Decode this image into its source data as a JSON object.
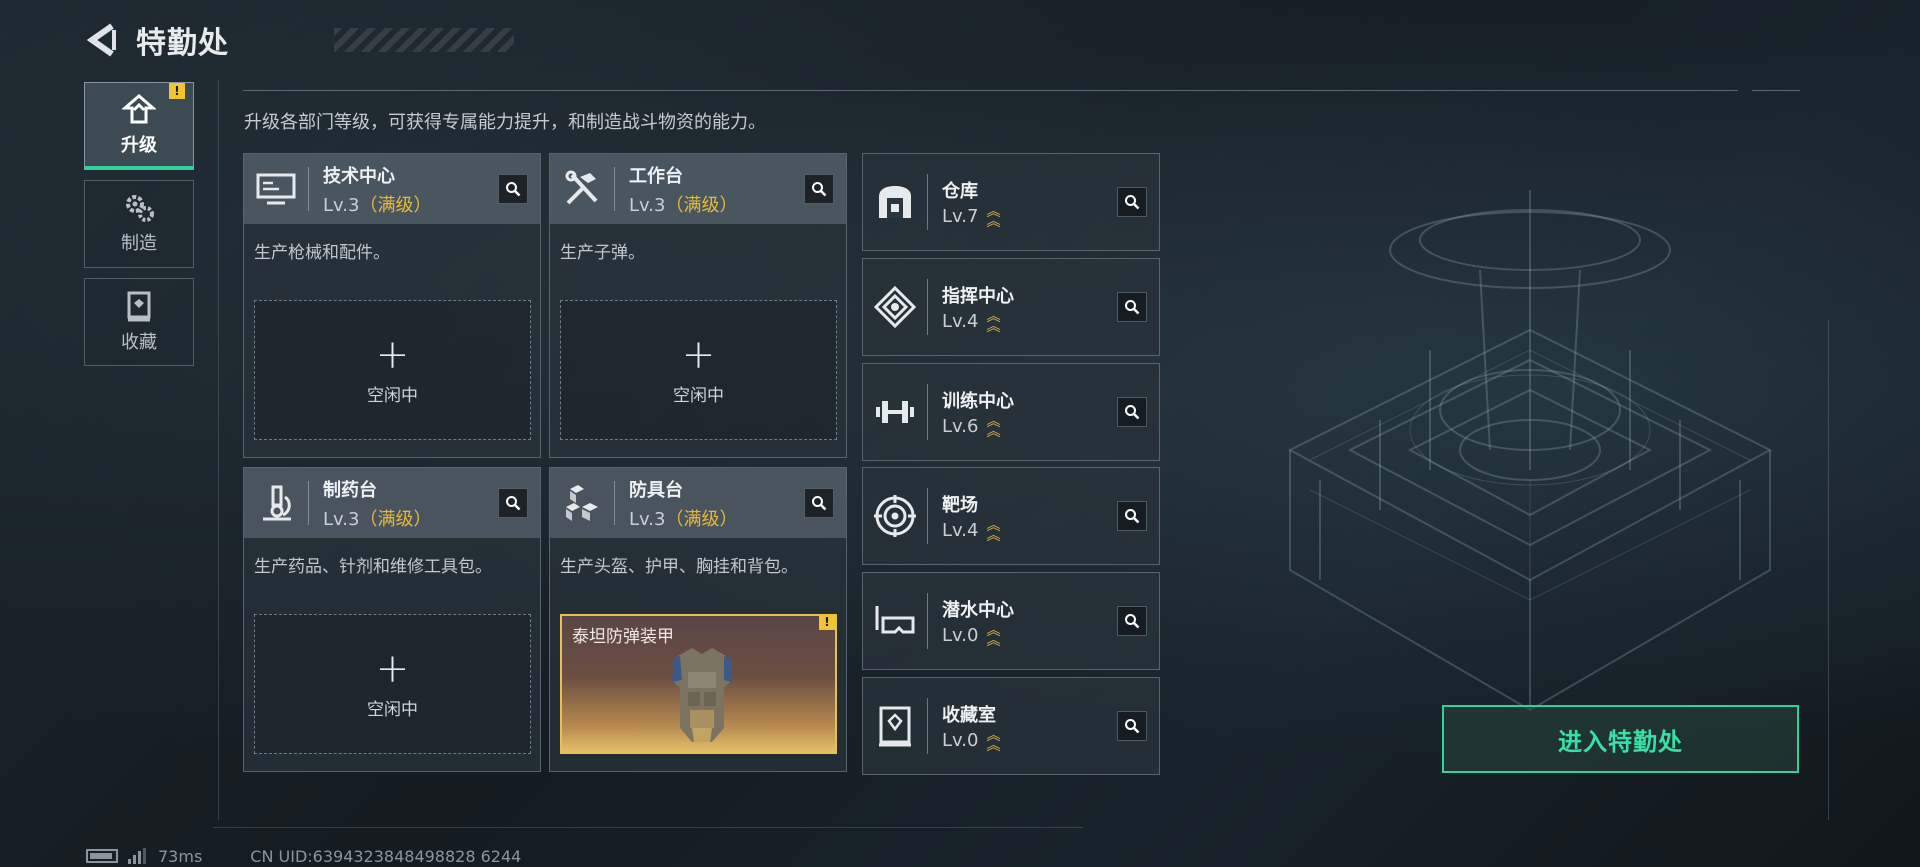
{
  "header": {
    "title": "特勤处"
  },
  "nav": {
    "items": [
      {
        "label": "升级",
        "icon": "upgrade-icon",
        "active": true,
        "alert": "!"
      },
      {
        "label": "制造",
        "icon": "gears-icon",
        "active": false
      },
      {
        "label": "收藏",
        "icon": "collection-icon",
        "active": false
      }
    ]
  },
  "description": "升级各部门等级，可获得专属能力提升，和制造战斗物资的能力。",
  "cards": [
    {
      "name": "技术中心",
      "level": "Lv.3",
      "max": "（满级）",
      "desc": "生产枪械和配件。",
      "slot_plus": "+",
      "slot_status": "空闲中",
      "icon": "computer-icon"
    },
    {
      "name": "工作台",
      "level": "Lv.3",
      "max": "（满级）",
      "desc": "生产子弹。",
      "slot_plus": "+",
      "slot_status": "空闲中",
      "icon": "tools-icon"
    },
    {
      "name": "制药台",
      "level": "Lv.3",
      "max": "（满级）",
      "desc": "生产药品、针剂和维修工具包。",
      "slot_plus": "+",
      "slot_status": "空闲中",
      "icon": "microscope-icon"
    },
    {
      "name": "防具台",
      "level": "Lv.3",
      "max": "（满级）",
      "desc": "生产头盔、护甲、胸挂和背包。",
      "slot_item": "泰坦防弹装甲",
      "slot_alert": "!",
      "icon": "armor-parts-icon"
    }
  ],
  "facilities": [
    {
      "name": "仓库",
      "level": "Lv.7",
      "icon": "warehouse-icon"
    },
    {
      "name": "指挥中心",
      "level": "Lv.4",
      "icon": "command-icon"
    },
    {
      "name": "训练中心",
      "level": "Lv.6",
      "icon": "dumbbell-icon"
    },
    {
      "name": "靶场",
      "level": "Lv.4",
      "icon": "target-icon"
    },
    {
      "name": "潜水中心",
      "level": "Lv.0",
      "icon": "diving-mask-icon"
    },
    {
      "name": "收藏室",
      "level": "Lv.0",
      "icon": "vault-icon"
    }
  ],
  "enter_button": "进入特勤处",
  "footer": {
    "ping": "73ms",
    "uid": "CN UID:6394323848498828 6244"
  },
  "colors": {
    "accent": "#2fd39a",
    "max_level": "#e9b93c",
    "alert": "#f0c433"
  }
}
